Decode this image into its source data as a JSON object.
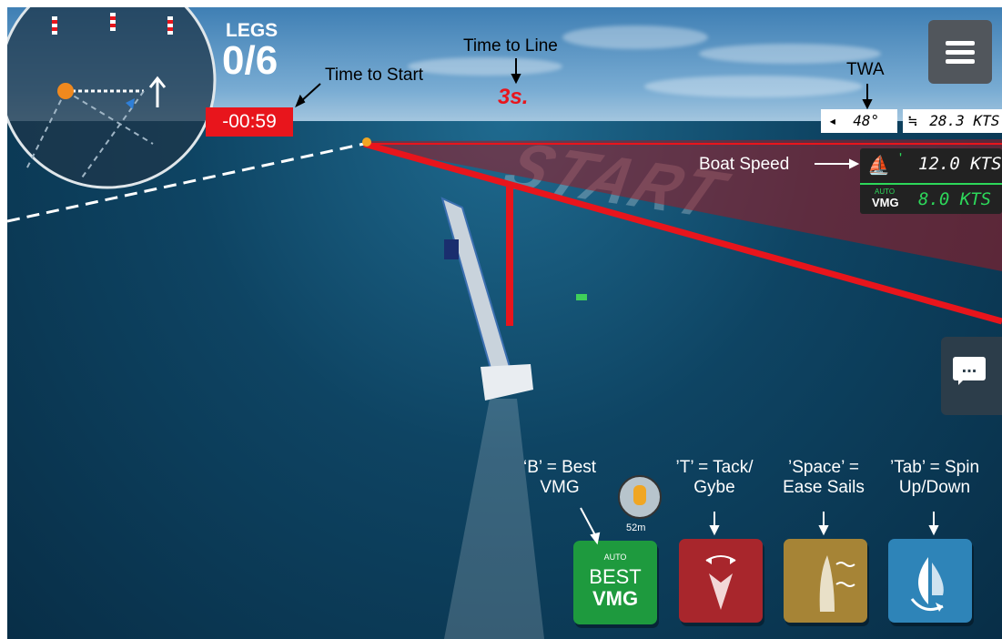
{
  "hud": {
    "legs_label": "LEGS",
    "legs_value": "0/6",
    "countdown": "-00:59",
    "time_to_line": "3s.",
    "twa_value": "48°",
    "wind_speed": "28.3 KTS",
    "boat_speed": "12.0 KTS",
    "vmg_auto_label": "AUTO",
    "vmg_label": "VMG",
    "vmg_value": "8.0 KTS",
    "banner_text": "START"
  },
  "mark": {
    "distance": "52m"
  },
  "annotations": {
    "time_to_start": "Time to Start",
    "time_to_line": "Time to Line",
    "twa": "TWA",
    "boat_speed": "Boat Speed",
    "best_vmg_line1": "‘B’ = Best",
    "best_vmg_line2": "VMG",
    "tack_line1": "’T’ = Tack/",
    "tack_line2": "Gybe",
    "ease_line1": "’Space’ =",
    "ease_line2": "Ease Sails",
    "spin_line1": "’Tab’ = Spin",
    "spin_line2": "Up/Down"
  },
  "buttons": {
    "best_auto": "AUTO",
    "best_best": "BEST",
    "best_vmg": "VMG"
  },
  "icons": {
    "menu": "hamburger-menu-icon",
    "chat": "chat-icon",
    "wind": "wind-icon",
    "twa": "wind-angle-icon",
    "boat": "sailboat-icon",
    "tack": "tack-gybe-icon",
    "ease": "ease-sails-icon",
    "spin": "spinnaker-icon"
  },
  "colors": {
    "countdown_bg": "#e8151c",
    "time_to_line": "#e8151c",
    "vmg_green": "#2dd85a",
    "best_vmg_button": "#1e9a3e",
    "tack_button": "#a8262c",
    "ease_button": "#a68436",
    "spin_button": "#2e84b8",
    "start_line": "#e8151c"
  }
}
